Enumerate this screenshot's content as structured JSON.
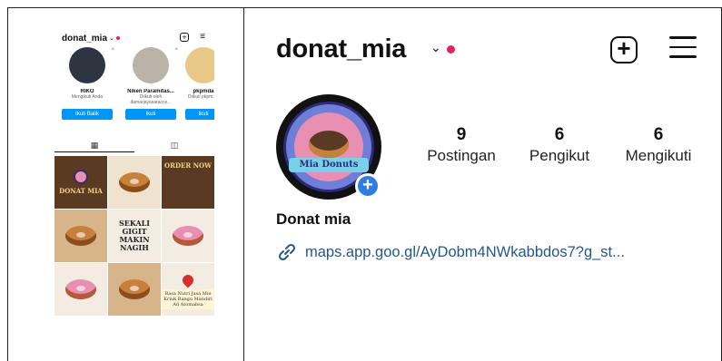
{
  "mini": {
    "username": "donat_mia",
    "suggestions": [
      {
        "name": "RIKO",
        "sub": "Mengikuti Anda",
        "button": "Ikuti Balik"
      },
      {
        "name": "Niken Paramitas...",
        "sub": "Diikuti oleh damarjayasaracce...",
        "button": "Ikuti"
      },
      {
        "name": "pkpmda",
        "sub": "Diikuti pkpm.sa",
        "button": "Ikuti"
      }
    ],
    "tiles": {
      "brand": "DONAT MIA",
      "order": "ORDER NOW",
      "tagline": [
        "SEKALI",
        "GIGIT",
        "MAKIN",
        "NAGIH"
      ],
      "sign": "Rasa Nutri Jasa Mie Kriuk Bangu Mandiri Ad Atomabsa"
    }
  },
  "profile": {
    "username": "donat_mia",
    "avatar_text": "Mia Donuts",
    "stats": [
      {
        "value": "9",
        "label": "Postingan"
      },
      {
        "value": "6",
        "label": "Pengikut"
      },
      {
        "value": "6",
        "label": "Mengikuti"
      }
    ],
    "display_name": "Donat mia",
    "link": "maps.app.goo.gl/AyDobm4NWkabbdos7?g_st..."
  },
  "colors": {
    "accent": "#0095f6",
    "notif": "#e0245e",
    "link": "#23578c"
  }
}
